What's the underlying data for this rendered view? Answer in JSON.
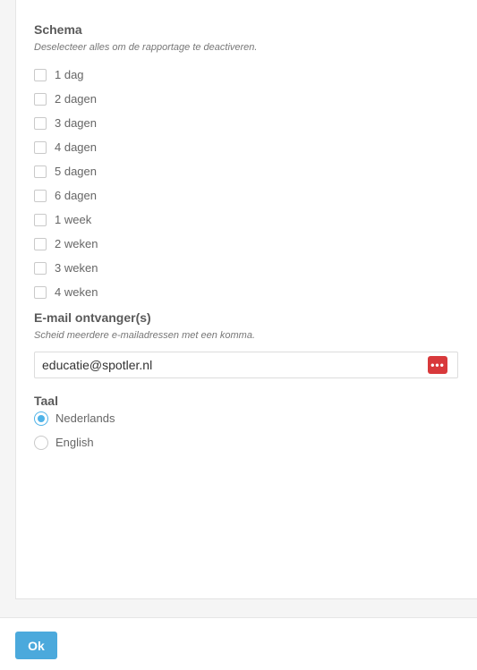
{
  "schedule": {
    "title": "Schema",
    "hint": "Deselecteer alles om de rapportage te deactiveren.",
    "options": [
      {
        "label": "1 dag",
        "checked": false
      },
      {
        "label": "2 dagen",
        "checked": false
      },
      {
        "label": "3 dagen",
        "checked": false
      },
      {
        "label": "4 dagen",
        "checked": false
      },
      {
        "label": "5 dagen",
        "checked": false
      },
      {
        "label": "6 dagen",
        "checked": false
      },
      {
        "label": "1 week",
        "checked": false
      },
      {
        "label": "2 weken",
        "checked": false
      },
      {
        "label": "3 weken",
        "checked": false
      },
      {
        "label": "4 weken",
        "checked": false
      }
    ]
  },
  "email": {
    "title": "E-mail ontvanger(s)",
    "hint": "Scheid meerdere e-mailadressen met een komma.",
    "value": "educatie@spotler.nl",
    "badge_icon": "password-manager-icon",
    "badge_text": "•••",
    "badge_color": "#d8393b"
  },
  "language": {
    "title": "Taal",
    "options": [
      {
        "label": "Nederlands",
        "selected": true
      },
      {
        "label": "English",
        "selected": false
      }
    ],
    "accent_color": "#4fb3e8"
  },
  "footer": {
    "ok_label": "Ok",
    "button_color": "#4ba9dc"
  }
}
